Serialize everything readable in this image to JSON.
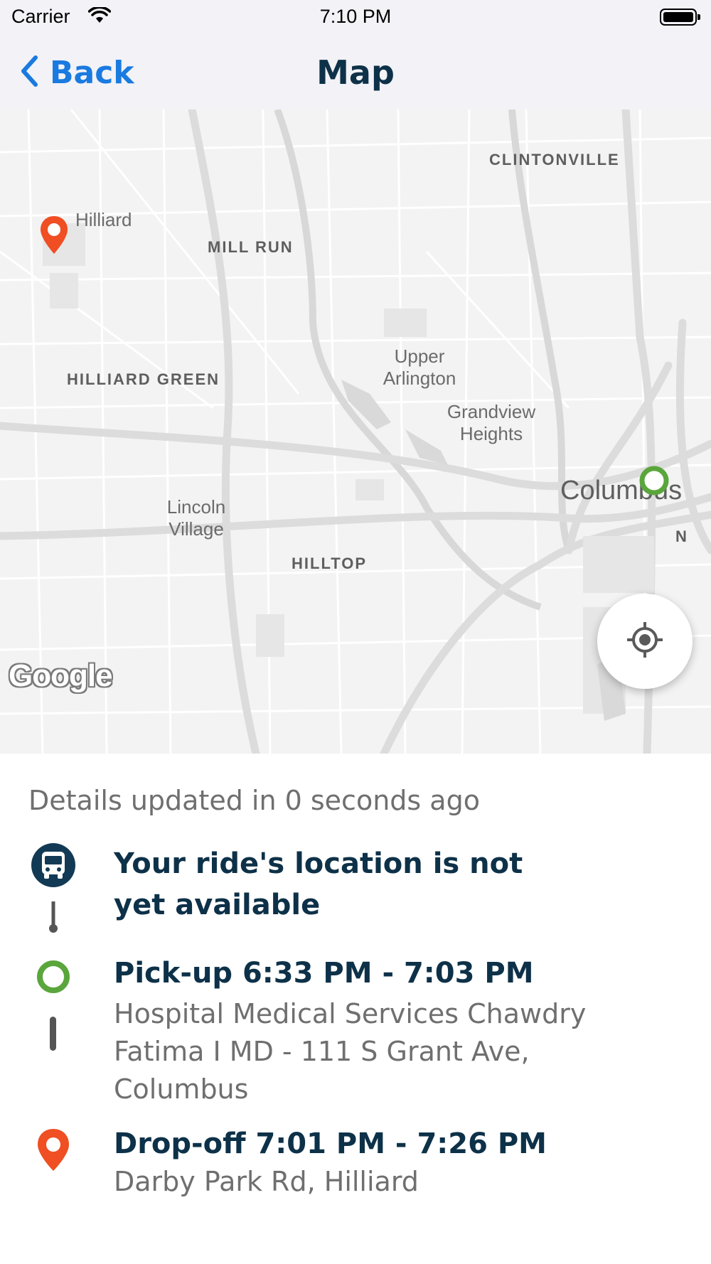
{
  "status_bar": {
    "carrier": "Carrier",
    "time": "7:10 PM"
  },
  "nav": {
    "back_label": "Back",
    "title": "Map"
  },
  "map": {
    "labels": {
      "clintonville": "CLINTONVILLE",
      "hilliard": "Hilliard",
      "mill_run": "MILL RUN",
      "hilliard_green": "HILLIARD GREEN",
      "upper_arlington_1": "Upper",
      "upper_arlington_2": "Arlington",
      "grandview_1": "Grandview",
      "grandview_2": "Heights",
      "columbus": "Columbus",
      "lincoln_1": "Lincoln",
      "lincoln_2": "Village",
      "hilltop": "HILLTOP",
      "partial": "N"
    },
    "attribution": "Google",
    "pickup_marker_color": "#5aa63c",
    "dropoff_marker_color": "#f04e23"
  },
  "details": {
    "updated_text": "Details updated in 0 seconds ago",
    "ride_status": "Your ride's location is not yet available",
    "pickup_title": "Pick-up 6:33 PM - 7:03 PM",
    "pickup_address": "Hospital Medical Services Chawdry Fatima I MD - 111 S Grant Ave, Columbus",
    "dropoff_title": "Drop-off 7:01 PM - 7:26 PM",
    "dropoff_address": "Darby Park Rd, Hilliard"
  },
  "colors": {
    "accent": "#1a7ae0",
    "title_text": "#0d3148",
    "secondary_text": "#6f6f6f",
    "ride_icon_bg": "#123a55"
  }
}
